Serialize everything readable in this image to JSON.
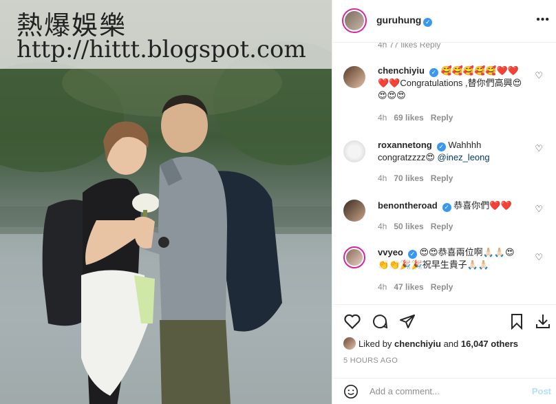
{
  "watermark": {
    "line1": "熱爆娛樂",
    "line2": "http://hittt.blogspot.com"
  },
  "header": {
    "username": "guruhung",
    "verified_icon": "verified-badge-icon",
    "more_icon": "more-options-icon"
  },
  "cut_comment_meta": "4h    77 likes    Reply",
  "comments": [
    {
      "username": "chenchiyiu",
      "verified": true,
      "text_prefix": "🥰🥰🥰🥰🥰❤️❤️❤️❤️",
      "text": "Congratulations ,替你們高興😍😍😍😍",
      "mention": "",
      "time": "4h",
      "likes": "69 likes",
      "reply": "Reply"
    },
    {
      "username": "roxannetong",
      "verified": true,
      "text_prefix": "",
      "text": "Wahhhh congratzzzz😍 ",
      "mention": "@inez_leong",
      "time": "4h",
      "likes": "70 likes",
      "reply": "Reply"
    },
    {
      "username": "benontheroad",
      "verified": true,
      "text_prefix": "",
      "text": "恭喜你們❤️❤️",
      "mention": "",
      "time": "4h",
      "likes": "50 likes",
      "reply": "Reply"
    },
    {
      "username": "vvyeo",
      "verified": true,
      "text_prefix": "",
      "text": "😍😍恭喜兩位啊🙏🏻🙏🏻😍👏👏🎉🎉祝早生貴子🙏🏻🙏🏻",
      "mention": "",
      "time": "4h",
      "likes": "47 likes",
      "reply": "Reply"
    }
  ],
  "actions": {
    "like_icon": "heart-icon",
    "comment_icon": "comment-icon",
    "share_icon": "share-icon",
    "save_icon": "bookmark-icon",
    "download_icon": "download-icon"
  },
  "likes_line": {
    "prefix": "Liked by ",
    "user": "chenchiyiu",
    "middle": " and ",
    "count": "16,047 others"
  },
  "timestamp": "5 HOURS AGO",
  "add_comment": {
    "placeholder": "Add a comment...",
    "post_label": "Post"
  },
  "colors": {
    "verified": "#3897f0",
    "mention": "#00376b",
    "muted": "#8e8e8e",
    "post_disabled": "#b2dffc"
  }
}
